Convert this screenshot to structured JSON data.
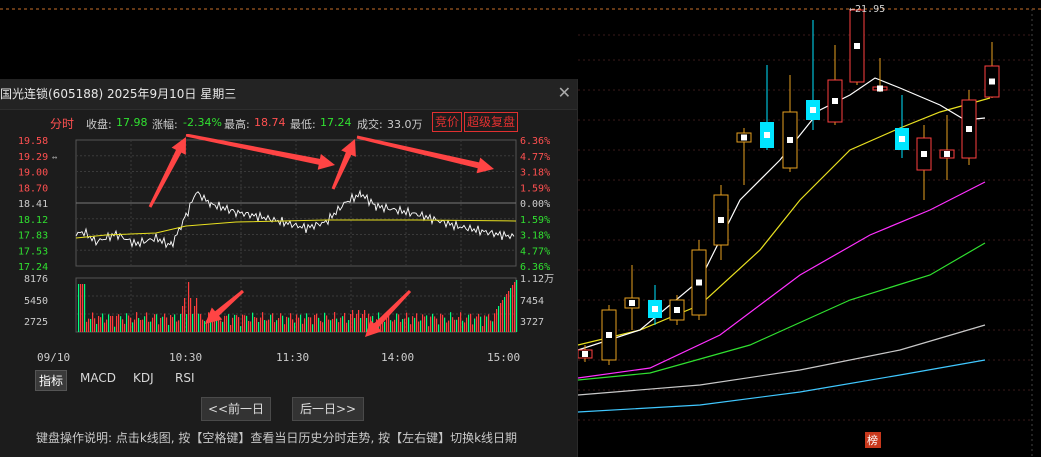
{
  "main_chart": {
    "high_marker": "←21.95",
    "badge": "榜"
  },
  "popup": {
    "title": "国光连锁(605188) 2025年9月10日 星期三",
    "info": {
      "tab_label": "分时",
      "close_label": "收盘:",
      "close_value": "17.98",
      "change_label": "涨幅:",
      "change_value": "-2.34%",
      "high_label": "最高:",
      "high_value": "18.74",
      "low_label": "最低:",
      "low_value": "17.24",
      "volume_label": "成交:",
      "volume_value": "33.0万"
    },
    "auction_button": "竞价",
    "super_replay_button": "超级复盘",
    "price_axis_left": [
      "19.58",
      "19.29",
      "19.00",
      "18.70",
      "18.41",
      "18.12",
      "17.83",
      "17.53",
      "17.24"
    ],
    "price_axis_right": [
      "6.36%",
      "4.77%",
      "3.18%",
      "1.59%",
      "0.00%",
      "1.59%",
      "3.18%",
      "4.77%",
      "6.36%"
    ],
    "volume_axis_left": [
      "8176",
      "5450",
      "2725"
    ],
    "volume_axis_right": [
      "1.12万",
      "7454",
      "3727"
    ],
    "time_labels": [
      "09/10",
      "10:30",
      "11:30",
      "14:00",
      "15:00"
    ],
    "indicator_tabs": [
      "指标",
      "MACD",
      "KDJ",
      "RSI"
    ],
    "prev_day_button": "<<前一日",
    "next_day_button": "后一日>>",
    "help_text": "键盘操作说明: 点击k线图, 按【空格键】查看当日历史分时走势, 按【左右键】切换k线日期"
  },
  "colors": {
    "up": "#ff3c3c",
    "down": "#00ff80",
    "avg_line": "#e8e020",
    "price_line": "#ffffff",
    "ma_white": "#ffffff",
    "ma_yellow": "#e8e020",
    "ma_magenta": "#ff30ff",
    "ma_green": "#30e030",
    "ma_gray": "#c8c8c8",
    "ma_blue": "#40c8ff",
    "arrow": "#ff4444"
  }
}
